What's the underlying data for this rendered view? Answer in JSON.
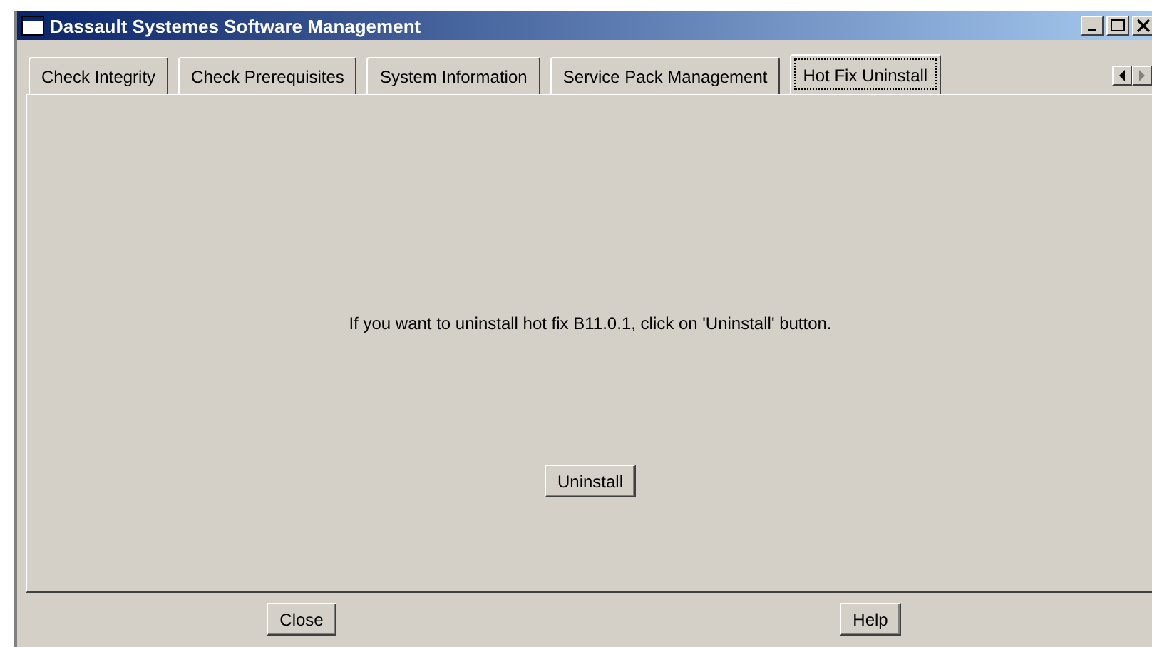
{
  "window": {
    "title": "Dassault Systemes Software Management"
  },
  "tabs": [
    {
      "label": "Check Integrity",
      "selected": false
    },
    {
      "label": "Check Prerequisites",
      "selected": false
    },
    {
      "label": "System Information",
      "selected": false
    },
    {
      "label": "Service Pack Management",
      "selected": false
    },
    {
      "label": "Hot Fix Uninstall",
      "selected": true
    }
  ],
  "panel": {
    "message": "If you want to uninstall hot fix B11.0.1, click on 'Uninstall' button.",
    "button": "Uninstall"
  },
  "buttons": [
    "Close",
    "Help"
  ]
}
